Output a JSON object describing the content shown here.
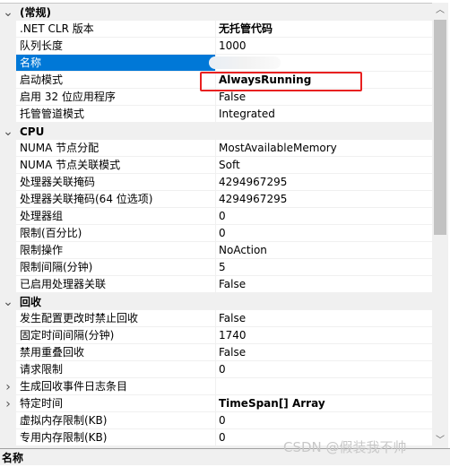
{
  "rows": [
    {
      "type": "cat",
      "label": "(常规)",
      "expander": "chevron-down"
    },
    {
      "type": "prop",
      "name": ".NET CLR 版本",
      "value": "无托管代码",
      "bold": true
    },
    {
      "type": "prop",
      "name": "队列长度",
      "value": "1000"
    },
    {
      "type": "prop",
      "name": "名称",
      "value": "",
      "selected": true,
      "blurred": true
    },
    {
      "type": "prop",
      "name": "启动模式",
      "value": "AlwaysRunning",
      "bold": true,
      "highlighted": true
    },
    {
      "type": "prop",
      "name": "启用 32 位应用程序",
      "value": "False"
    },
    {
      "type": "prop",
      "name": "托管管道模式",
      "value": "Integrated"
    },
    {
      "type": "cat",
      "label": "CPU",
      "expander": "chevron-down"
    },
    {
      "type": "prop",
      "name": "NUMA 节点分配",
      "value": "MostAvailableMemory"
    },
    {
      "type": "prop",
      "name": "NUMA 节点关联模式",
      "value": "Soft"
    },
    {
      "type": "prop",
      "name": "处理器关联掩码",
      "value": "4294967295"
    },
    {
      "type": "prop",
      "name": "处理器关联掩码(64 位选项)",
      "value": "4294967295"
    },
    {
      "type": "prop",
      "name": "处理器组",
      "value": "0"
    },
    {
      "type": "prop",
      "name": "限制(百分比)",
      "value": "0"
    },
    {
      "type": "prop",
      "name": "限制操作",
      "value": "NoAction"
    },
    {
      "type": "prop",
      "name": "限制间隔(分钟)",
      "value": "5"
    },
    {
      "type": "prop",
      "name": "已启用处理器关联",
      "value": "False"
    },
    {
      "type": "cat",
      "label": "回收",
      "expander": "chevron-down"
    },
    {
      "type": "prop",
      "name": "发生配置更改时禁止回收",
      "value": "False"
    },
    {
      "type": "prop",
      "name": "固定时间间隔(分钟)",
      "value": "1740"
    },
    {
      "type": "prop",
      "name": "禁用重叠回收",
      "value": "False"
    },
    {
      "type": "prop",
      "name": "请求限制",
      "value": "0"
    },
    {
      "type": "prop",
      "name": "生成回收事件日志条目",
      "value": "",
      "expander": "chevron-right"
    },
    {
      "type": "prop",
      "name": "特定时间",
      "value": "TimeSpan[] Array",
      "bold": true,
      "expander": "chevron-right"
    },
    {
      "type": "prop",
      "name": "虚拟内存限制(KB)",
      "value": "0"
    },
    {
      "type": "prop",
      "name": "专用内存限制(KB)",
      "value": "0"
    }
  ],
  "description": {
    "title": "名称"
  },
  "watermark": "CSDN @假装我不帅",
  "colors": {
    "selection": "#0078d7",
    "highlight_box": "#e82020"
  }
}
